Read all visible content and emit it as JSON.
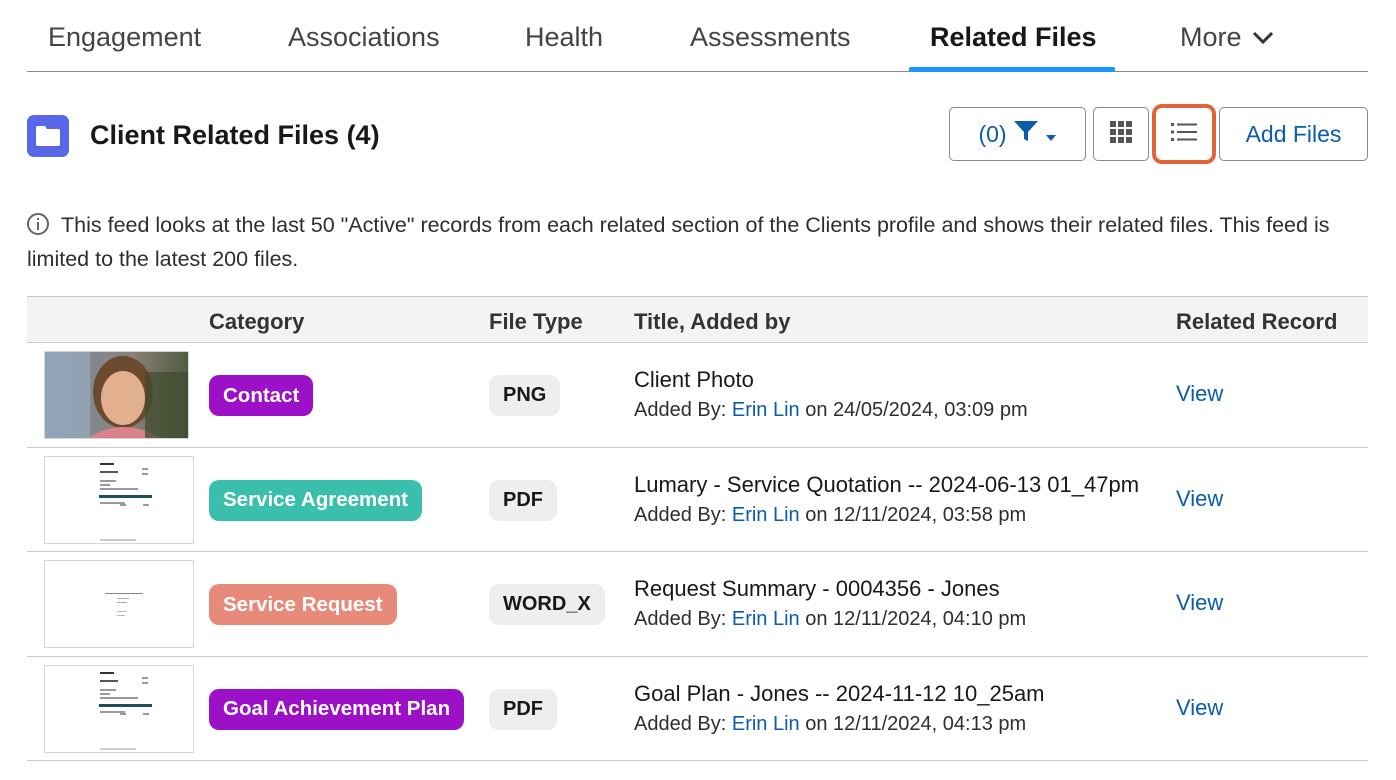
{
  "tabs": [
    {
      "label": "Engagement"
    },
    {
      "label": "Associations"
    },
    {
      "label": "Health"
    },
    {
      "label": "Assessments"
    },
    {
      "label": "Related Files",
      "active": true
    },
    {
      "label": "More"
    }
  ],
  "header": {
    "title": "Client Related Files (4)",
    "filter_label": "(0)",
    "add_files_label": "Add Files"
  },
  "info_text": "This feed looks at the last 50 \"Active\" records from each related section of the Clients profile and shows their related files. This feed is limited to the latest 200 files.",
  "table": {
    "columns": [
      "Category",
      "File Type",
      "Title, Added by",
      "Related Record"
    ],
    "added_by_prefix": "Added By:",
    "on_word": "on",
    "rows": [
      {
        "category": "Contact",
        "category_color": "#9c10c8",
        "file_type": "PNG",
        "title": "Client Photo",
        "added_by": "Erin Lin",
        "date": "24/05/2024, 03:09 pm",
        "related": "View",
        "thumb_kind": "photo"
      },
      {
        "category": "Service Agreement",
        "category_color": "#3bbfad",
        "file_type": "PDF",
        "title": "Lumary - Service Quotation -- 2024-06-13 01_47pm",
        "added_by": "Erin Lin",
        "date": "12/11/2024, 03:58 pm",
        "related": "View",
        "thumb_kind": "doc"
      },
      {
        "category": "Service Request",
        "category_color": "#e88a7a",
        "file_type": "WORD_X",
        "title": "Request Summary - 0004356 - Jones",
        "added_by": "Erin Lin",
        "date": "12/11/2024, 04:10 pm",
        "related": "View",
        "thumb_kind": "word"
      },
      {
        "category": "Goal Achievement Plan",
        "category_color": "#9c10c8",
        "file_type": "PDF",
        "title": "Goal Plan - Jones -- 2024-11-12 10_25am",
        "added_by": "Erin Lin",
        "date": "12/11/2024, 04:13 pm",
        "related": "View",
        "thumb_kind": "doc"
      }
    ]
  },
  "colors": {
    "accent": "#1b96ff",
    "link": "#0b5cab",
    "highlight": "#e2643c",
    "folder": "#5867e8"
  },
  "icons": [
    "folder-icon",
    "chevron-down-icon",
    "filter-icon",
    "caret-down-icon",
    "grid-icon",
    "list-icon",
    "info-icon"
  ]
}
